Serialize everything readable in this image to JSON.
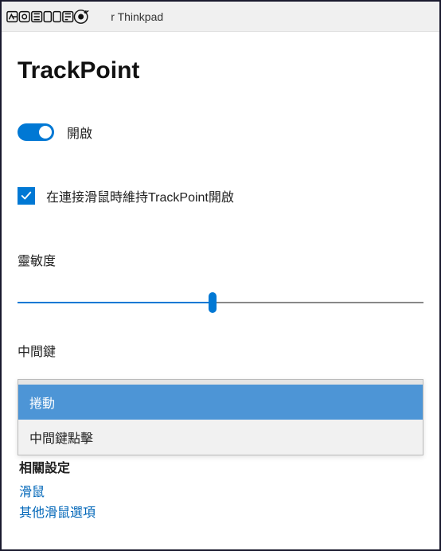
{
  "header": {
    "logo_alt": "MOBILE01",
    "title_suffix": "r Thinkpad"
  },
  "page": {
    "title": "TrackPoint",
    "toggle": {
      "state": "on",
      "label": "開啟"
    },
    "checkbox": {
      "checked": true,
      "label": "在連接滑鼠時維持TrackPoint開啟"
    },
    "sensitivity": {
      "label": "靈敏度",
      "value_percent": 48
    },
    "middle_button": {
      "label": "中間鍵",
      "options": [
        {
          "text": "捲動",
          "selected": true
        },
        {
          "text": "中間鍵點擊",
          "selected": false
        }
      ]
    },
    "related_settings_label_fragment": "相關設定",
    "links": [
      {
        "text": "滑鼠"
      },
      {
        "text": "其他滑鼠選項"
      }
    ]
  }
}
